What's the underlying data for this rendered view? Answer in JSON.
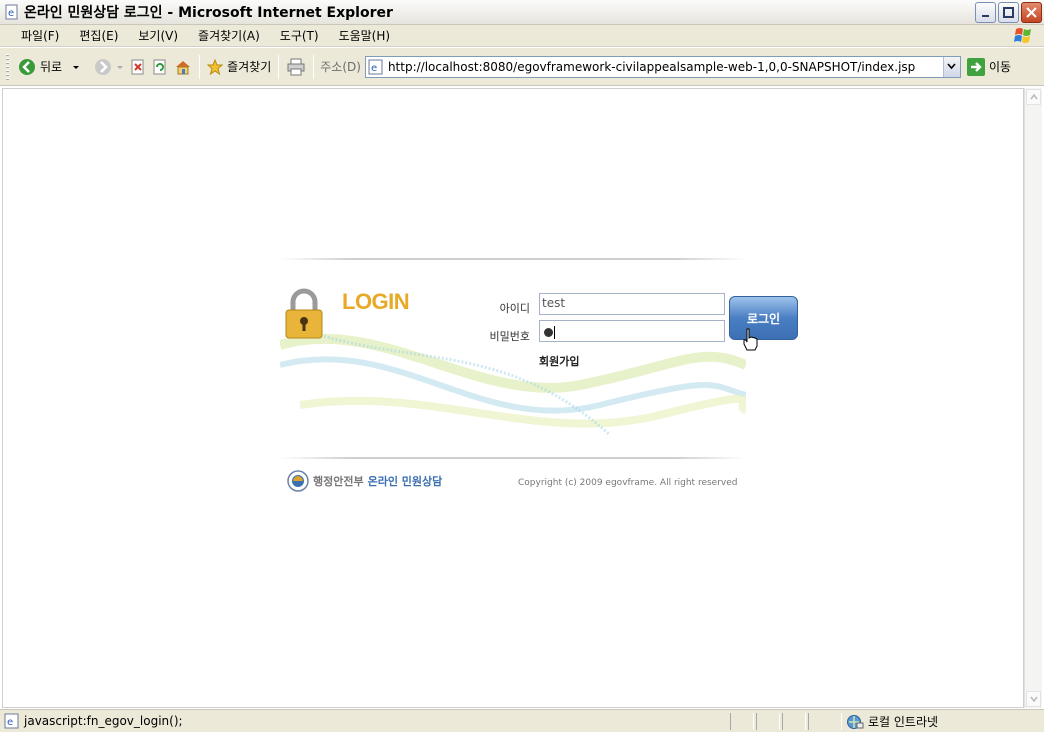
{
  "window": {
    "title": "온라인 민원상담 로그인 - Microsoft Internet Explorer",
    "minimize": "minimize",
    "maximize": "maximize",
    "close": "close"
  },
  "menu": {
    "items": [
      "파일(F)",
      "편집(E)",
      "보기(V)",
      "즐겨찾기(A)",
      "도구(T)",
      "도움말(H)"
    ]
  },
  "toolbar": {
    "back_label": "뒤로",
    "favorites_label": "즐겨찾기",
    "address_label": "주소(D)",
    "url": "http://localhost:8080/egovframework-civilappealsample-web-1,0,0-SNAPSHOT/index.jsp",
    "go_label": "이동"
  },
  "login": {
    "title": "LOGIN",
    "id_label": "아이디",
    "id_value": "test",
    "password_label": "비밀번호",
    "password_masked": "●",
    "login_button": "로그인",
    "signup_link": "회원가입",
    "ministry": "행정안전부",
    "service": "온라인 민원상담",
    "copyright": "Copyright (c) 2009 egovframe. All right reserved"
  },
  "status": {
    "text": "javascript:fn_egov_login();",
    "zone": "로컬 인트라넷"
  },
  "colors": {
    "login_title": "#e8a927",
    "login_button": "#4a7fc3",
    "service_text": "#3a6fb0"
  }
}
